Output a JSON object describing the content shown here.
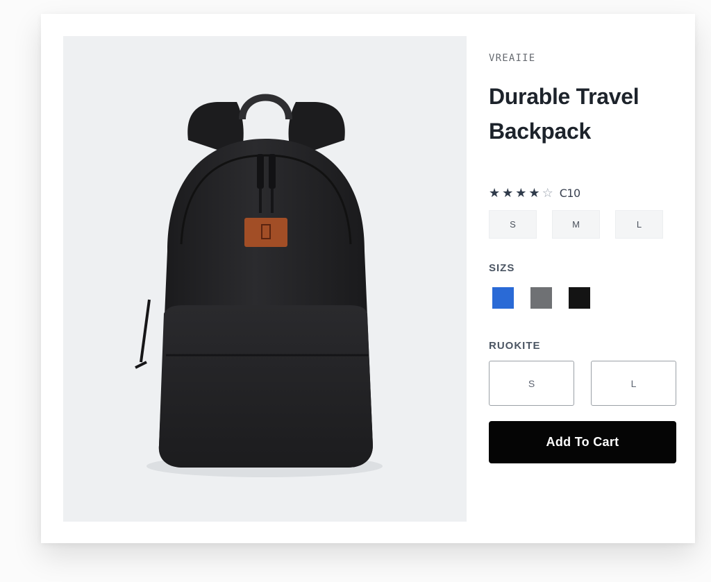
{
  "product": {
    "eyebrow": "VREAIIE",
    "title": "Durable Travel Backpack",
    "rating": {
      "stars": [
        "★",
        "★",
        "★",
        "★",
        "☆"
      ],
      "value": 4,
      "max": 5,
      "count_text": "C10"
    }
  },
  "size_chips": [
    "S",
    "M",
    "L"
  ],
  "colors": {
    "label": "SIZS",
    "swatches": [
      {
        "name": "blue",
        "hex": "#2a6ad6"
      },
      {
        "name": "gray",
        "hex": "#6f7174"
      },
      {
        "name": "black",
        "hex": "#141414"
      }
    ]
  },
  "options": {
    "label": "RUOKITE",
    "buttons": [
      "S",
      "L"
    ]
  },
  "cart": {
    "label": "Add To Cart"
  },
  "image": {
    "subject": "backpack-product-photo",
    "backpack_color": "#1f1f21",
    "patch_color": "#a24e26",
    "background": "#eef0f2"
  }
}
